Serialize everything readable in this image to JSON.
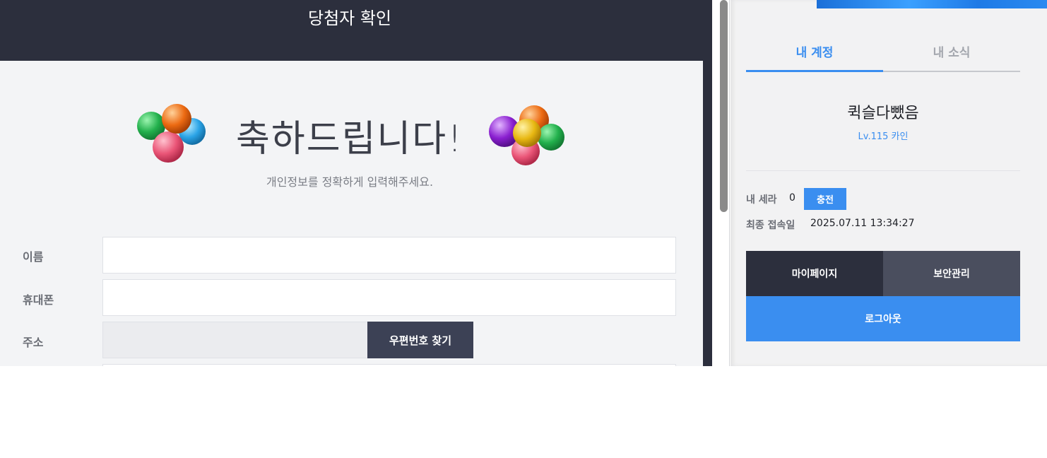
{
  "modal": {
    "title": "당첨자 확인",
    "headline": "축하드립니다!",
    "subtitle": "개인정보를 정확하게 입력해주세요.",
    "form": {
      "name_label": "이름",
      "phone_label": "휴대폰",
      "address_label": "주소",
      "zip_button": "우편번호 찾기"
    }
  },
  "account_panel": {
    "tabs": [
      "내 계정",
      "내 소식"
    ],
    "nickname": "퀵슬다뺐음",
    "character": "Lv.115 카인",
    "sera_label": "내 세라",
    "sera_value": "0",
    "charge_button": "충전",
    "last_login_label": "최종 접속일",
    "last_login_value": "2025.07.11 13:34:27",
    "buttons": {
      "mypage": "마이페이지",
      "security": "보안관리",
      "logout": "로그아웃"
    }
  },
  "colors": {
    "dark": "#2c2f3d",
    "accent": "#3a8ef0",
    "card": "#f3f4f6"
  }
}
